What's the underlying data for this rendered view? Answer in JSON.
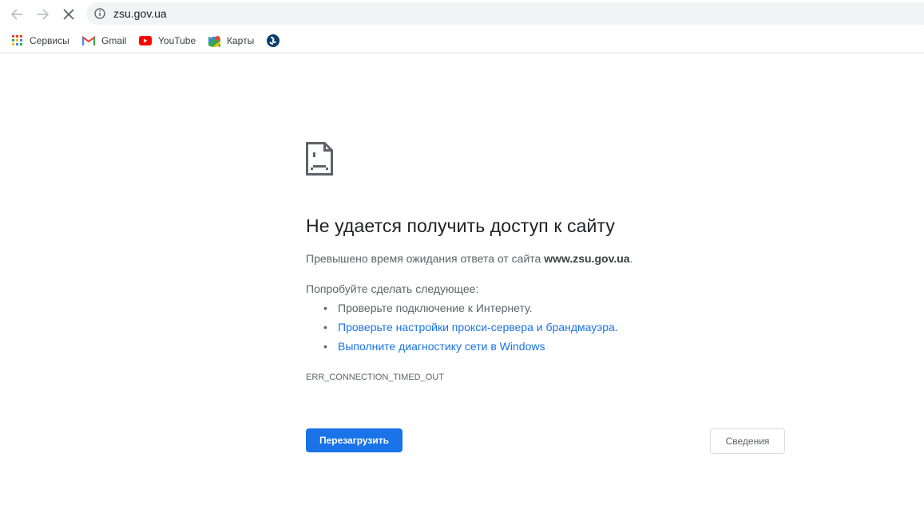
{
  "browser": {
    "url": "zsu.gov.ua",
    "nav": {
      "back_icon": "arrow-left",
      "forward_icon": "arrow-right",
      "stop_icon": "close"
    },
    "bookmarks": [
      {
        "label": "Сервисы",
        "icon": "apps-grid"
      },
      {
        "label": "Gmail",
        "icon": "gmail"
      },
      {
        "label": "YouTube",
        "icon": "youtube"
      },
      {
        "label": "Карты",
        "icon": "maps"
      },
      {
        "label": "",
        "icon": "globe"
      }
    ]
  },
  "error": {
    "icon": "sad-page",
    "title": "Не удается получить доступ к сайту",
    "desc_prefix": "Превышено время ожидания ответа от сайта ",
    "desc_host": "www.zsu.gov.ua",
    "desc_suffix": ".",
    "try_label": "Попробуйте сделать следующее:",
    "suggestions": [
      "Проверьте подключение к Интернету.",
      "Проверьте настройки прокси-сервера и брандмауэра.",
      "Выполните диагностику сети в Windows"
    ],
    "code": "ERR_CONNECTION_TIMED_OUT",
    "reload_label": "Перезагрузить",
    "details_label": "Сведения"
  },
  "colors": {
    "accent": "#1a73e8",
    "text": "#5f6368",
    "heading": "#202124"
  }
}
